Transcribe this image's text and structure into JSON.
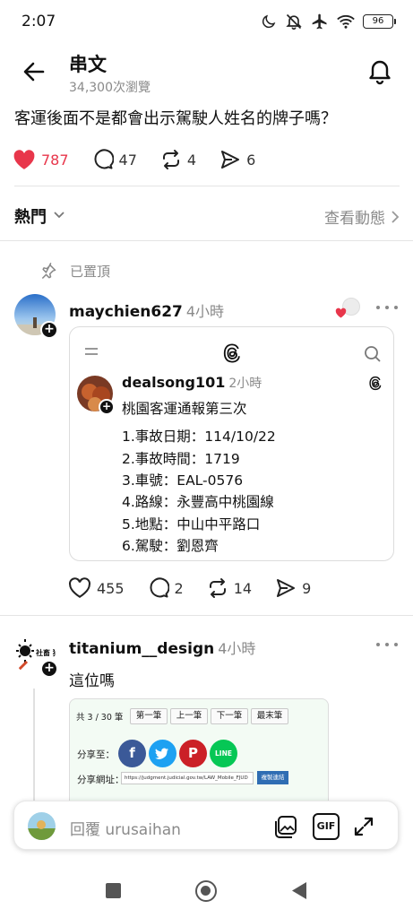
{
  "status_bar": {
    "time": "2:07",
    "battery": "96"
  },
  "header": {
    "title": "串文",
    "views": "34,300次瀏覽"
  },
  "post": {
    "text": "客運後面不是都會出示駕駛人姓名的牌子嗎？",
    "likes": "787",
    "comments": "47",
    "reposts": "4",
    "shares": "6"
  },
  "sort": {
    "label": "熱門",
    "view_activity": "查看動態"
  },
  "pinned_label": "已置頂",
  "reply1": {
    "username": "maychien627",
    "time": "4小時",
    "embed": {
      "username": "dealsong101",
      "time": "2小時",
      "title": "桃園客運通報第三次",
      "lines": [
        "1.事故日期：114/10/22",
        "2.事故時間：1719",
        "3.車號：EAL-0576",
        "4.路線：永豐高中桃園線",
        "5.地點：中山中平路口",
        "6.駕駛：劉恩齊"
      ]
    },
    "likes": "455",
    "comments": "2",
    "reposts": "14",
    "shares": "9"
  },
  "reply2": {
    "username": "titanium__design",
    "time": "4小時",
    "text": "這位嗎",
    "avatar_text": "社畜 猜丁",
    "card": {
      "page_info": "共 3 / 30 筆",
      "btn_first": "第一筆",
      "btn_prev": "上一筆",
      "btn_next": "下一筆",
      "btn_last": "最末筆",
      "share_label": "分享至：",
      "url_label": "分享網址：",
      "url": "https://judgment.judicial.gov.tw/LAW_Mobile_FJUD",
      "copy_btn": "複製連結",
      "line_label": "LINE"
    }
  },
  "reply_bar": {
    "placeholder": "回覆 urusaihan",
    "gif_label": "GIF"
  },
  "colors": {
    "like_red": "#e8364b",
    "facebook": "#3b5998",
    "twitter": "#1da1f2",
    "pinterest": "#cb2027",
    "line": "#06c755"
  }
}
